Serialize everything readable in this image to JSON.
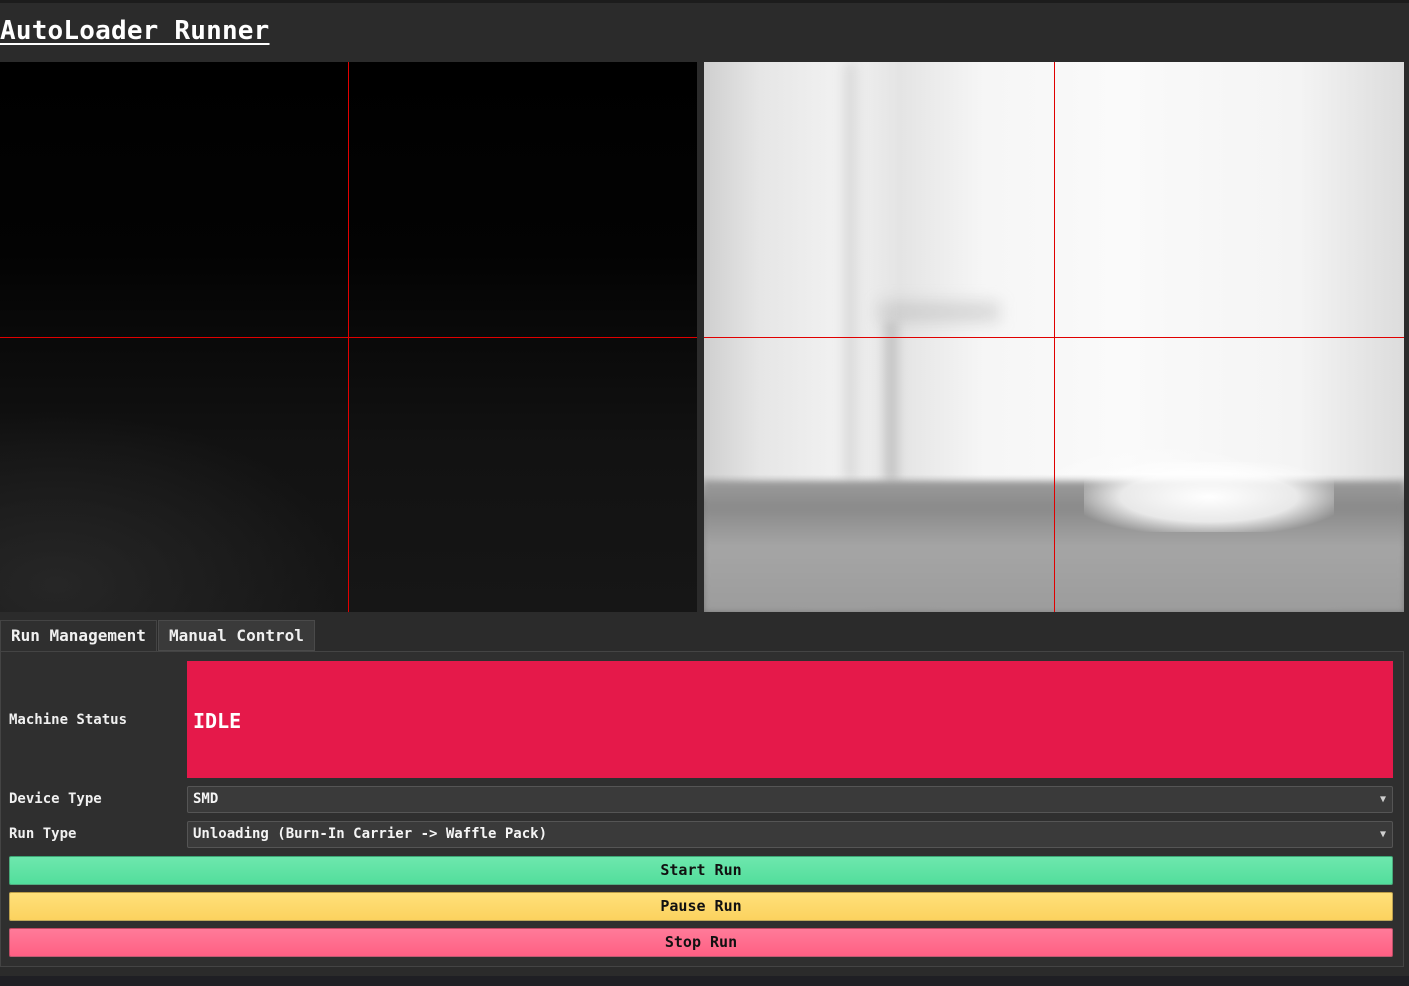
{
  "app": {
    "title": "AutoLoader Runner"
  },
  "cameras": [
    {
      "name": "left-camera",
      "crosshair_color": "#e00000"
    },
    {
      "name": "right-camera",
      "crosshair_color": "#e00000"
    }
  ],
  "tabs": [
    {
      "label": "Run Management",
      "active": true
    },
    {
      "label": "Manual Control",
      "active": false
    }
  ],
  "run_management": {
    "machine_status": {
      "label": "Machine Status",
      "value": "IDLE",
      "color": "#e5194a"
    },
    "device_type": {
      "label": "Device Type",
      "value": "SMD"
    },
    "run_type": {
      "label": "Run Type",
      "value": "Unloading (Burn-In Carrier -> Waffle Pack)"
    },
    "buttons": {
      "start": {
        "label": "Start Run",
        "color": "#52de9c"
      },
      "pause": {
        "label": "Pause Run",
        "color": "#fbd25f"
      },
      "stop": {
        "label": "Stop Run",
        "color": "#ff5f83"
      }
    }
  },
  "icons": {
    "select_chevron": "chevron-down-icon"
  }
}
